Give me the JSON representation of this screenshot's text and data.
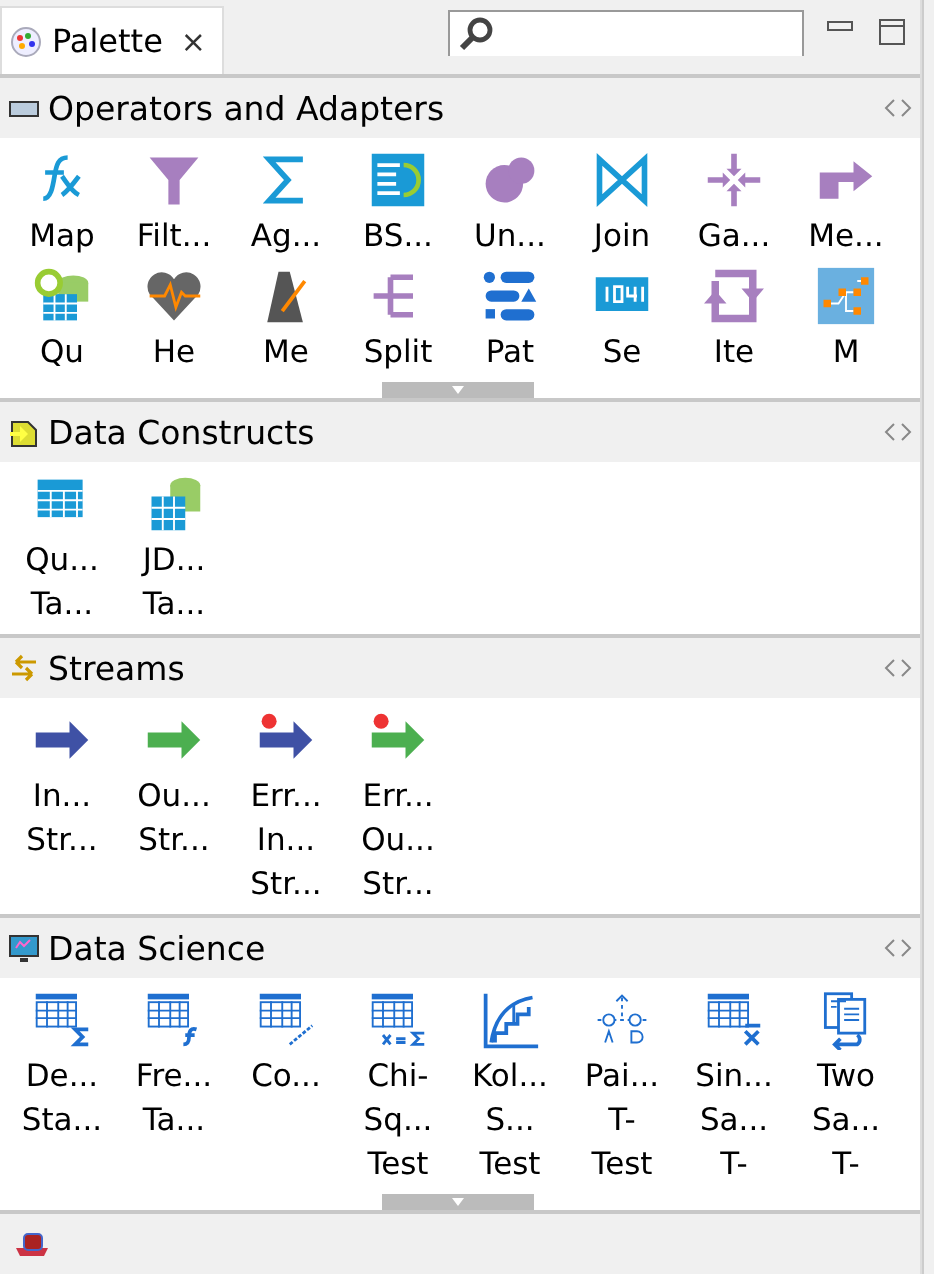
{
  "tab": {
    "title": "Palette",
    "selected": true,
    "close": "×"
  },
  "sections": [
    {
      "title": "Operators and Adapters",
      "items": [
        {
          "lines": [
            "Map"
          ]
        },
        {
          "lines": [
            "Filt..."
          ]
        },
        {
          "lines": [
            "Ag..."
          ]
        },
        {
          "lines": [
            "BS..."
          ]
        },
        {
          "lines": [
            "Un..."
          ]
        },
        {
          "lines": [
            "Join"
          ]
        },
        {
          "lines": [
            "Ga..."
          ]
        },
        {
          "lines": [
            "Me..."
          ]
        },
        {
          "lines": [
            "Qu"
          ]
        },
        {
          "lines": [
            "He"
          ]
        },
        {
          "lines": [
            "Me"
          ]
        },
        {
          "lines": [
            "Split"
          ]
        },
        {
          "lines": [
            "Pat"
          ]
        },
        {
          "lines": [
            "Se"
          ]
        },
        {
          "lines": [
            "Ite"
          ]
        },
        {
          "lines": [
            "M"
          ]
        }
      ],
      "scroll_handle": true
    },
    {
      "title": "Data Constructs",
      "items": [
        {
          "lines": [
            "Qu...",
            "Ta..."
          ]
        },
        {
          "lines": [
            "JD...",
            "Ta..."
          ]
        }
      ],
      "scroll_handle": false
    },
    {
      "title": "Streams",
      "items": [
        {
          "lines": [
            "In...",
            "Str..."
          ]
        },
        {
          "lines": [
            "Ou...",
            "Str..."
          ]
        },
        {
          "lines": [
            "Err...",
            "In...",
            "Str..."
          ]
        },
        {
          "lines": [
            "Err...",
            "Ou...",
            "Str..."
          ]
        }
      ],
      "scroll_handle": false
    },
    {
      "title": "Data Science",
      "items": [
        {
          "lines": [
            "De...",
            "Sta..."
          ]
        },
        {
          "lines": [
            "Fre...",
            "Ta..."
          ]
        },
        {
          "lines": [
            "Co..."
          ]
        },
        {
          "lines": [
            "Chi-",
            "Sq...",
            "Test"
          ]
        },
        {
          "lines": [
            "Kol...",
            "S...",
            "Test"
          ]
        },
        {
          "lines": [
            "Pai...",
            "T-",
            "Test"
          ]
        },
        {
          "lines": [
            "Sin...",
            "Sa...",
            "T-"
          ]
        },
        {
          "lines": [
            "Two",
            "Sa...",
            "T-"
          ]
        }
      ],
      "scroll_handle": true
    }
  ]
}
